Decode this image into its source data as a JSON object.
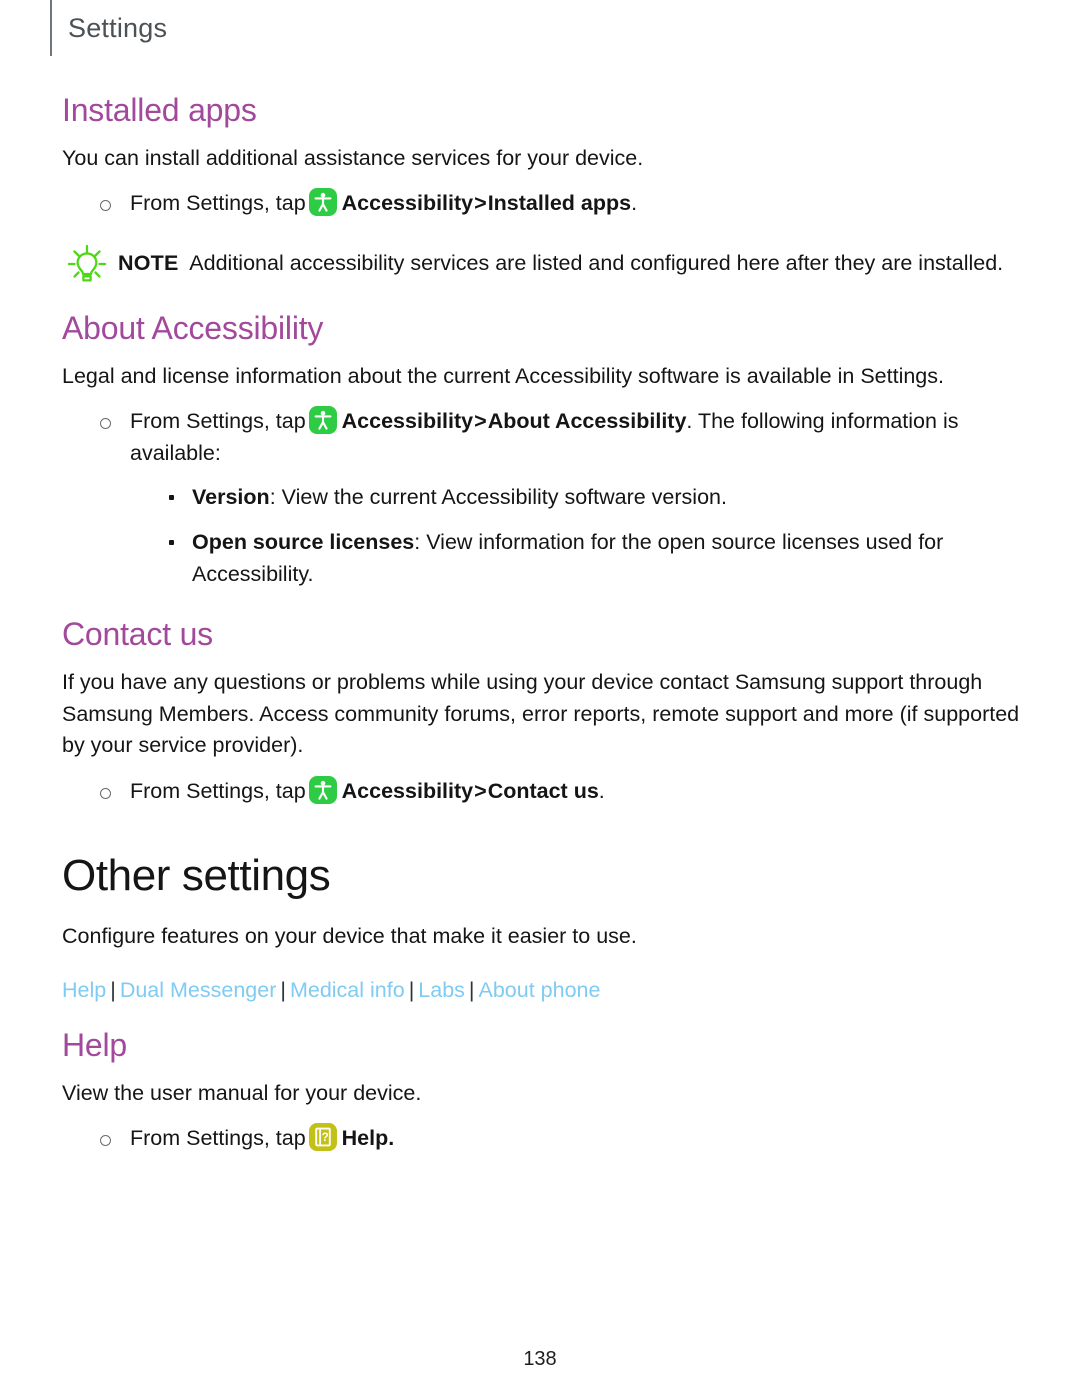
{
  "header": {
    "title": "Settings"
  },
  "sections": {
    "installed_apps": {
      "heading": "Installed apps",
      "intro": "You can install additional assistance services for your device.",
      "step": {
        "prefix": "From Settings, tap",
        "icon": "accessibility-icon",
        "app": "Accessibility",
        "chevron": ">",
        "target": "Installed apps",
        "suffix": "."
      },
      "note": {
        "icon": "lightbulb-icon",
        "label": "NOTE",
        "text": "Additional accessibility services are listed and configured here after they are installed."
      }
    },
    "about_accessibility": {
      "heading": "About Accessibility",
      "intro": "Legal and license information about the current Accessibility software is available in Settings.",
      "step": {
        "prefix": "From Settings, tap",
        "icon": "accessibility-icon",
        "app": "Accessibility",
        "chevron": ">",
        "target": "About Accessibility",
        "suffix": ". The following information is available:"
      },
      "items": [
        {
          "term": "Version",
          "description": ": View the current Accessibility software version."
        },
        {
          "term": "Open source licenses",
          "description": ": View information for the open source licenses used for Accessibility."
        }
      ]
    },
    "contact_us": {
      "heading": "Contact us",
      "intro": "If you have any questions or problems while using your device contact Samsung support through Samsung Members. Access community forums, error reports, remote support and more (if supported by your service provider).",
      "step": {
        "prefix": "From Settings, tap",
        "icon": "accessibility-icon",
        "app": "Accessibility",
        "chevron": ">",
        "target": "Contact us",
        "suffix": "."
      }
    },
    "other_settings": {
      "heading": "Other settings",
      "intro": "Configure features on your device that make it easier to use.",
      "links": [
        "Help",
        "Dual Messenger",
        "Medical info",
        "Labs",
        "About phone"
      ],
      "link_separator": "|"
    },
    "help": {
      "heading": "Help",
      "intro": "View the user manual for your device.",
      "step": {
        "prefix": "From Settings, tap",
        "icon": "help-icon",
        "target": "Help",
        "suffix": "."
      }
    }
  },
  "footer": {
    "page_number": "138"
  },
  "colors": {
    "heading_purple": "#a2499c",
    "link_blue": "#7fcbf2",
    "accessibility_icon_bg": "#2ecc44",
    "help_icon_bg": "#c3c017",
    "note_icon": "#4cd914",
    "header_gray": "#4b5154"
  }
}
